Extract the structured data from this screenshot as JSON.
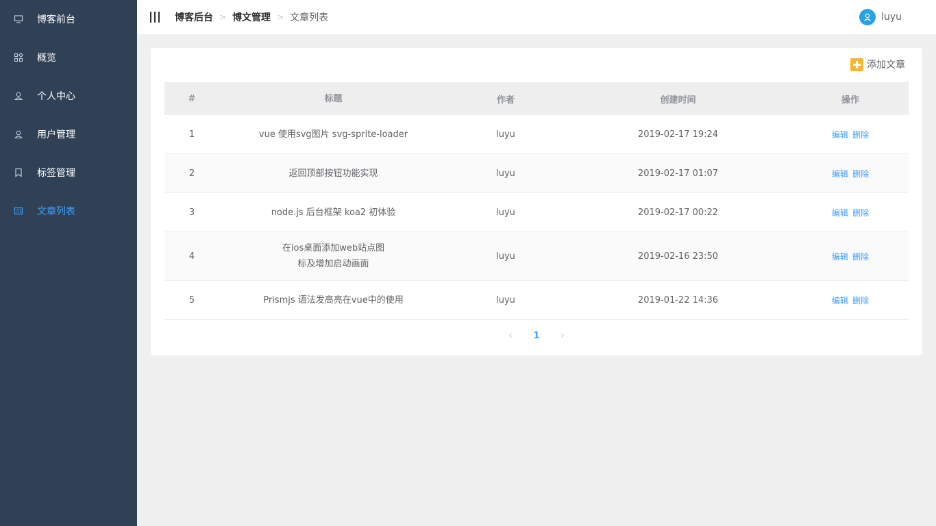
{
  "sidebar": {
    "items": [
      {
        "label": "博客前台",
        "icon": "monitor-icon",
        "active": false
      },
      {
        "label": "概览",
        "icon": "grid-icon",
        "active": false
      },
      {
        "label": "个人中心",
        "icon": "user-icon",
        "active": false
      },
      {
        "label": "用户管理",
        "icon": "user-icon",
        "active": false
      },
      {
        "label": "标签管理",
        "icon": "bookmark-icon",
        "active": false
      },
      {
        "label": "文章列表",
        "icon": "list-icon",
        "active": true
      }
    ],
    "colors": {
      "background": "#304156",
      "active": "#409eff"
    }
  },
  "header": {
    "breadcrumb": [
      "博客后台",
      "博文管理",
      "文章列表"
    ],
    "username": "luyu"
  },
  "toolbar": {
    "add_label": "添加文章"
  },
  "table": {
    "columns": [
      "#",
      "标题",
      "作者",
      "创建时间",
      "操作"
    ],
    "rows": [
      {
        "idx": "1",
        "title": "vue 使用svg图片 svg-sprite-loader",
        "author": "luyu",
        "created": "2019-02-17 19:24"
      },
      {
        "idx": "2",
        "title": "返回顶部按钮功能实现",
        "author": "luyu",
        "created": "2019-02-17 01:07"
      },
      {
        "idx": "3",
        "title": "node.js 后台框架 koa2 初体验",
        "author": "luyu",
        "created": "2019-02-17 00:22"
      },
      {
        "idx": "4",
        "title": "在ios桌面添加web站点图标及增加启动画面",
        "author": "luyu",
        "created": "2019-02-16 23:50"
      },
      {
        "idx": "5",
        "title": "Prismjs 语法发高亮在vue中的使用",
        "author": "luyu",
        "created": "2019-01-22 14:36"
      }
    ],
    "edit_label": "编辑",
    "delete_label": "删除"
  },
  "pagination": {
    "current": "1",
    "prev_icon": "chevron-left-icon",
    "next_icon": "chevron-right-icon"
  }
}
